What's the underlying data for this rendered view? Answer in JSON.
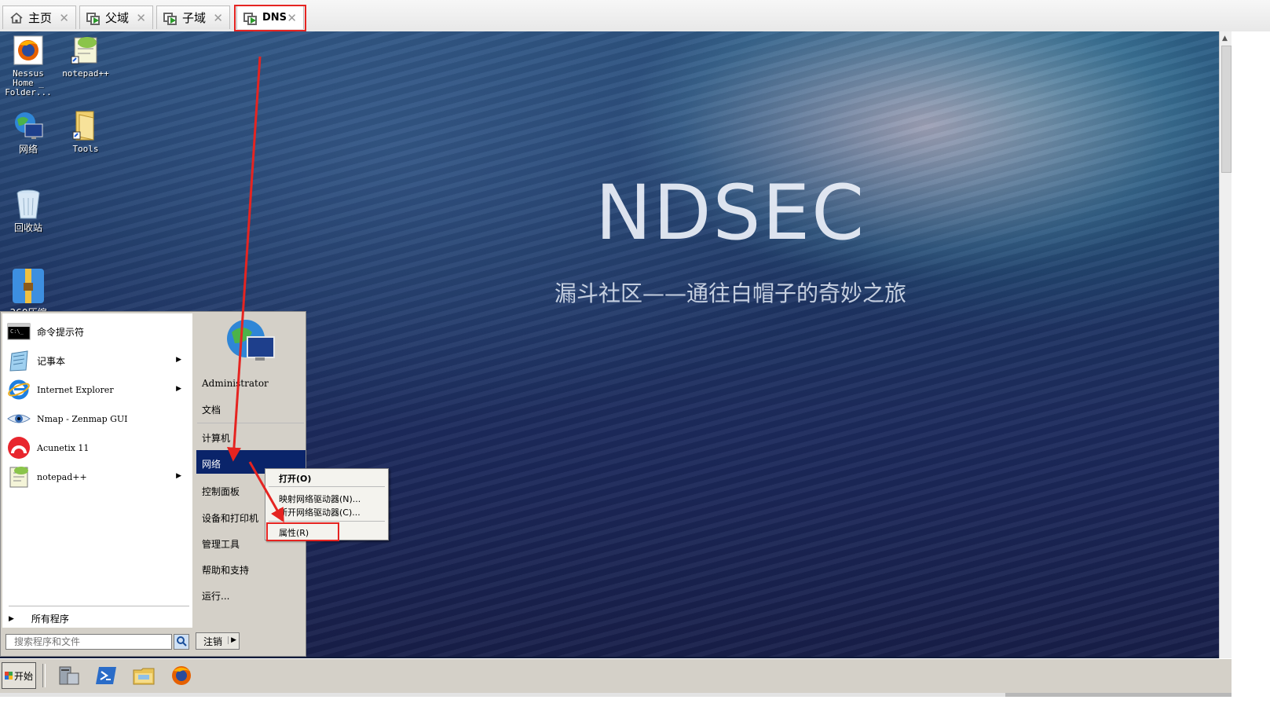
{
  "tabs": [
    {
      "label": "主页",
      "icon": "home-icon"
    },
    {
      "label": "父域",
      "icon": "vm-icon"
    },
    {
      "label": "子域",
      "icon": "vm-icon"
    },
    {
      "label": "DNS",
      "icon": "vm-icon",
      "active": true
    }
  ],
  "close_glyph": "✕",
  "desktop": {
    "brand_title": "NDSEC",
    "brand_subtitle": "漏斗社区——通往白帽子的奇妙之旅",
    "icons": [
      {
        "label": "Nessus Home _ Folder...",
        "icon": "firefox-icon"
      },
      {
        "label": "notepad++",
        "icon": "notepad-plus-plus-icon"
      },
      {
        "label": "网络",
        "icon": "network-globe-icon"
      },
      {
        "label": "Tools",
        "icon": "folder-icon"
      },
      {
        "label": "回收站",
        "icon": "recycle-bin-icon"
      },
      {
        "label": "360压缩",
        "icon": "archive-icon"
      }
    ]
  },
  "start_menu": {
    "pinned": [
      {
        "label": "命令提示符",
        "icon": "cmd-icon",
        "has_submenu": false
      },
      {
        "label": "记事本",
        "icon": "notepad-icon",
        "has_submenu": true
      },
      {
        "label": "Internet Explorer",
        "icon": "ie-icon",
        "has_submenu": true
      },
      {
        "label": "Nmap - Zenmap GUI",
        "icon": "nmap-eye-icon",
        "has_submenu": false
      },
      {
        "label": "Acunetix 11",
        "icon": "acunetix-icon",
        "has_submenu": false
      },
      {
        "label": "notepad++",
        "icon": "notepad-plus-plus-icon",
        "has_submenu": true
      }
    ],
    "all_programs": "所有程序",
    "search_placeholder": "搜索程序和文件",
    "user": "Administrator",
    "right_items": {
      "documents": "文档",
      "computer": "计算机",
      "network": "网络",
      "control_panel": "控制面板",
      "devices": "设备和打印机",
      "admin_tools": "管理工具",
      "help": "帮助和支持",
      "run": "运行..."
    },
    "logoff": "注销",
    "submenu_arrow": "▶"
  },
  "context_menu": {
    "open": "打开(O)",
    "map_drive": "映射网络驱动器(N)...",
    "disconnect_drive": "断开网络驱动器(C)...",
    "properties": "属性(R)"
  },
  "taskbar": {
    "start": "开始",
    "icons": [
      "server-manager-icon",
      "powershell-icon",
      "explorer-folder-icon",
      "firefox-icon"
    ]
  },
  "colors": {
    "annotation_red": "#e52421",
    "menu_highlight": "#0a246a"
  }
}
